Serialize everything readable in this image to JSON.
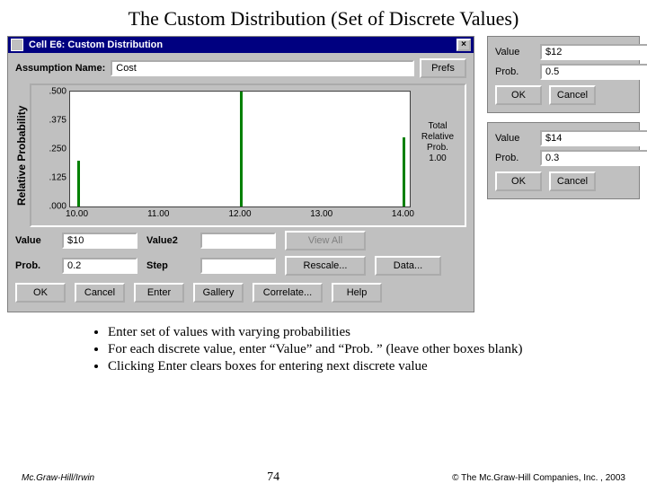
{
  "title": "The Custom Distribution (Set of Discrete Values)",
  "dialog": {
    "window_title": "Cell E6: Custom Distribution",
    "close_glyph": "×",
    "assumption_label": "Assumption Name:",
    "assumption_value": "Cost",
    "prefs_btn": "Prefs",
    "yaxis_label": "Relative Probability",
    "side_note_l1": "Total",
    "side_note_l2": "Relative",
    "side_note_l3": "Prob.",
    "side_note_val": "1.00",
    "value_label": "Value",
    "value_val": "$10",
    "value2_label": "Value2",
    "value2_val": "",
    "prob_label": "Prob.",
    "prob_val": "0.2",
    "step_label": "Step",
    "step_val": "",
    "viewall_btn": "View All",
    "rescale_btn": "Rescale...",
    "data_btn": "Data...",
    "ok_btn": "OK",
    "cancel_btn": "Cancel",
    "enter_btn": "Enter",
    "gallery_btn": "Gallery",
    "correlate_btn": "Correlate...",
    "help_btn": "Help"
  },
  "chart_data": {
    "type": "bar",
    "x_range": [
      10,
      14
    ],
    "x_ticks": [
      "10.00",
      "11.00",
      "12.00",
      "13.00",
      "14.00"
    ],
    "y_range": [
      0,
      0.5
    ],
    "y_ticks": [
      ".000",
      ".125",
      ".250",
      ".375",
      ".500"
    ],
    "points": [
      {
        "x": 10,
        "y": 0.2
      },
      {
        "x": 12,
        "y": 0.5
      },
      {
        "x": 14,
        "y": 0.3
      }
    ],
    "ylabel": "Relative Probability"
  },
  "popups": [
    {
      "value_label": "Value",
      "value_val": "$12",
      "prob_label": "Prob.",
      "prob_val": "0.5",
      "ok": "OK",
      "cancel": "Cancel"
    },
    {
      "value_label": "Value",
      "value_val": "$14",
      "prob_label": "Prob.",
      "prob_val": "0.3",
      "ok": "OK",
      "cancel": "Cancel"
    }
  ],
  "bullets": [
    "Enter set of values with varying probabilities",
    "For each discrete value, enter “Value” and “Prob. ” (leave other boxes blank)",
    "Clicking Enter clears boxes for entering next discrete value"
  ],
  "footer": {
    "left": "Mc.Graw-Hill/Irwin",
    "center": "74",
    "right": "© The Mc.Graw-Hill Companies, Inc. , 2003"
  }
}
